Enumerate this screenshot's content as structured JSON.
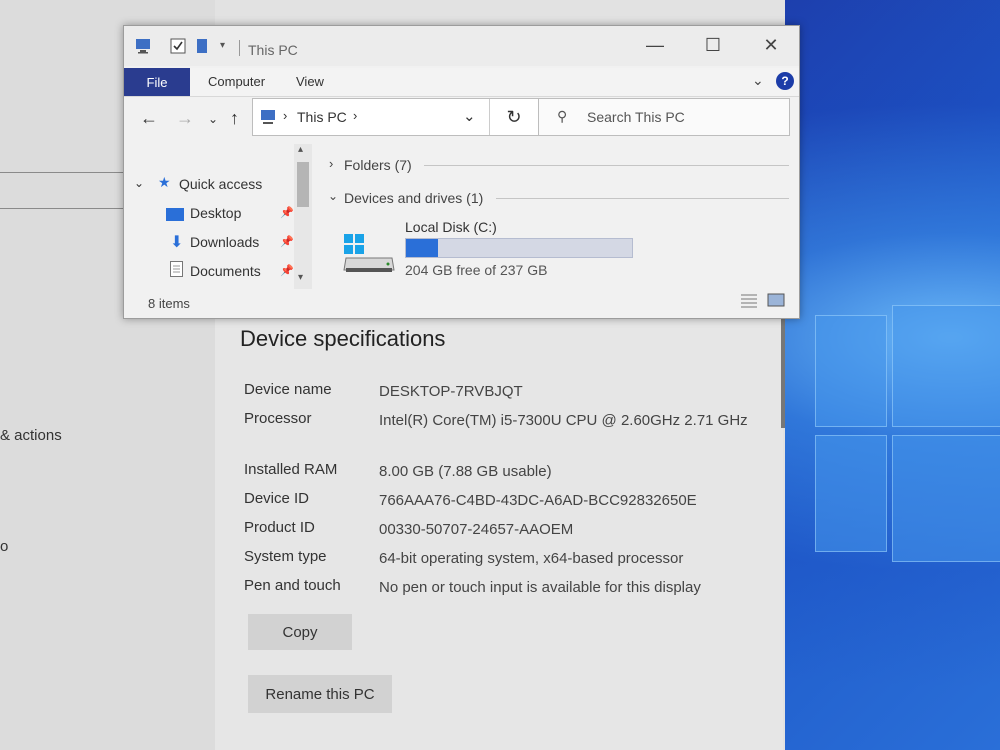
{
  "explorer": {
    "title": "This PC",
    "ribbon_tabs": [
      "File",
      "Computer",
      "View"
    ],
    "help": "?",
    "address_path": "This PC",
    "search_placeholder": "Search This PC",
    "nav": {
      "quick_access": "Quick access",
      "items": [
        "Desktop",
        "Downloads",
        "Documents"
      ]
    },
    "groups": {
      "folders": "Folders (7)",
      "devices": "Devices and drives (1)"
    },
    "drive": {
      "name": "Local Disk (C:)",
      "free_text": "204 GB free of 237 GB",
      "used_fraction": 0.14
    },
    "status": "8 items"
  },
  "settings": {
    "left_partial_1": "& actions",
    "left_partial_2": "o",
    "section_title": "Device specifications",
    "specs": [
      {
        "label": "Device name",
        "value": "DESKTOP-7RVBJQT"
      },
      {
        "label": "Processor",
        "value": "Intel(R) Core(TM) i5-7300U CPU @ 2.60GHz   2.71 GHz"
      },
      {
        "label": "Installed RAM",
        "value": "8.00 GB (7.88 GB usable)"
      },
      {
        "label": "Device ID",
        "value": "766AAA76-C4BD-43DC-A6AD-BCC92832650E"
      },
      {
        "label": "Product ID",
        "value": "00330-50707-24657-AAOEM"
      },
      {
        "label": "System type",
        "value": "64-bit operating system, x64-based processor"
      },
      {
        "label": "Pen and touch",
        "value": "No pen or touch input is available for this display"
      }
    ],
    "copy_label": "Copy",
    "rename_label": "Rename this PC"
  },
  "colors": {
    "file_tab": "#2a3c8f",
    "drive_bar": "#2a6fd8",
    "wallpaper": "#1d3aa8"
  }
}
